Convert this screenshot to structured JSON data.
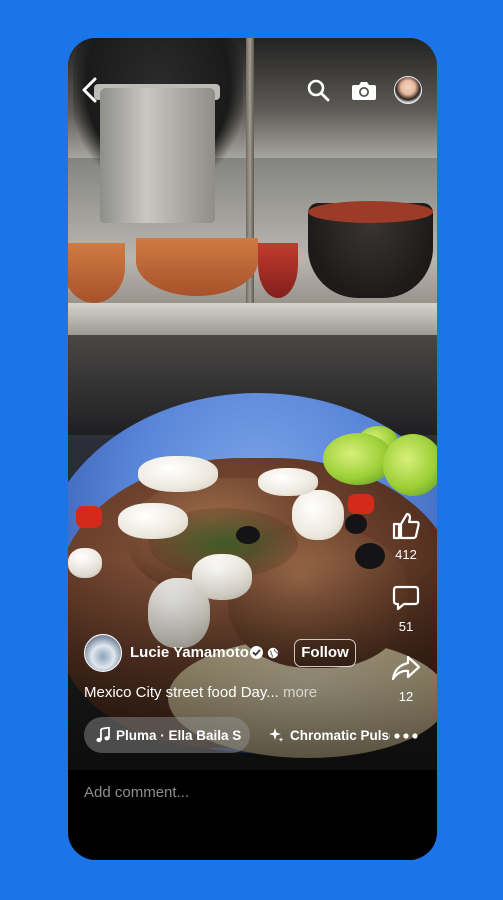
{
  "header": {
    "back_icon": "chevron-left-icon",
    "search_icon": "search-icon",
    "camera_icon": "camera-icon",
    "avatar": "profile-avatar"
  },
  "actions": {
    "like_count": "412",
    "comment_count": "51",
    "share_count": "12"
  },
  "post": {
    "author_name": "Lucie Yamamoto",
    "follow_label": "Follow",
    "caption": "Mexico City street food Day...",
    "more_label": "more",
    "music_label": "Pluma · Ella Baila S",
    "effect_label": "Chromatic Pulse"
  },
  "comment": {
    "placeholder": "Add comment..."
  },
  "colors": {
    "background": "#1b74e8",
    "screen": "#000000",
    "text": "#ffffff"
  }
}
